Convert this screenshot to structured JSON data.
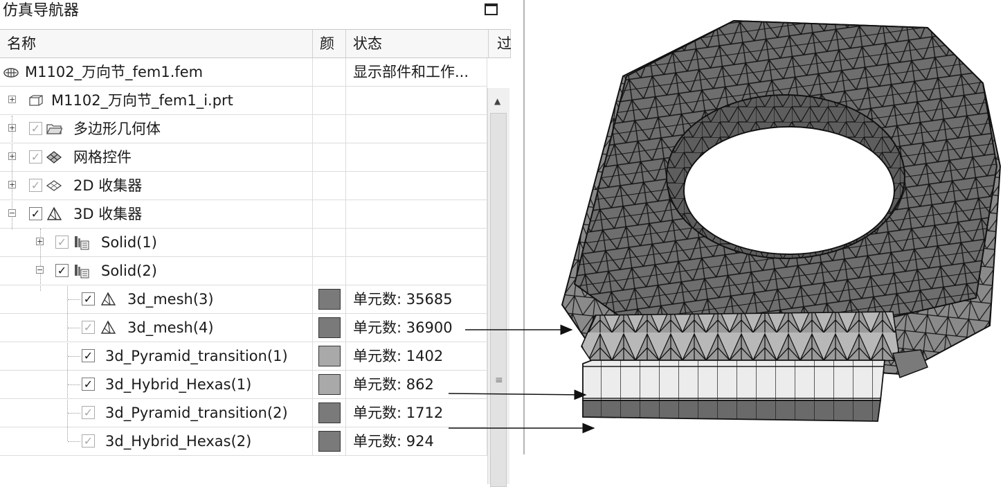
{
  "panel": {
    "title": "仿真导航器"
  },
  "columns": {
    "name": "名称",
    "color": "颜",
    "status": "状态",
    "extra": "过"
  },
  "rows": [
    {
      "label": "M1102_万向节_fem1.fem",
      "status": "显示部件和工作...",
      "icon": "fem-file-icon"
    },
    {
      "label": "M1102_万向节_fem1_i.prt",
      "status": "",
      "icon": "part-file-icon"
    },
    {
      "label": "多边形几何体",
      "status": "",
      "icon": "folder-icon",
      "checked": true
    },
    {
      "label": "网格控件",
      "status": "",
      "icon": "mesh-control-icon",
      "checked": true
    },
    {
      "label": "2D 收集器",
      "status": "",
      "icon": "2d-collector-icon",
      "checked": true
    },
    {
      "label": "3D 收集器",
      "status": "",
      "icon": "3d-collector-icon",
      "checked": true
    },
    {
      "label": "Solid(1)",
      "status": "",
      "icon": "solid-collector-icon",
      "checked": true
    },
    {
      "label": "Solid(2)",
      "status": "",
      "icon": "solid-collector-icon",
      "checked": true
    },
    {
      "label": "3d_mesh(3)",
      "status": "单元数: 35685",
      "icon": "3d-mesh-icon",
      "checked": true,
      "color": "#7a7a7a"
    },
    {
      "label": "3d_mesh(4)",
      "status": "单元数: 36900",
      "icon": "3d-mesh-icon",
      "checked": true,
      "color": "#7a7a7a"
    },
    {
      "label": "3d_Pyramid_transition(1)",
      "status": "单元数: 1402",
      "checked": true,
      "color": "#a9a9a9"
    },
    {
      "label": "3d_Hybrid_Hexas(1)",
      "status": "单元数: 862",
      "checked": true,
      "color": "#a9a9a9"
    },
    {
      "label": "3d_Pyramid_transition(2)",
      "status": "单元数: 1712",
      "checked": true,
      "color": "#7a7a7a"
    },
    {
      "label": "3d_Hybrid_Hexas(2)",
      "status": "单元数: 924",
      "checked": true,
      "color": "#7a7a7a"
    }
  ],
  "colors": {
    "mesh_dark": "#6e6e6e",
    "mesh_light": "#e6e6e6",
    "edge": "#1a1a1a"
  }
}
